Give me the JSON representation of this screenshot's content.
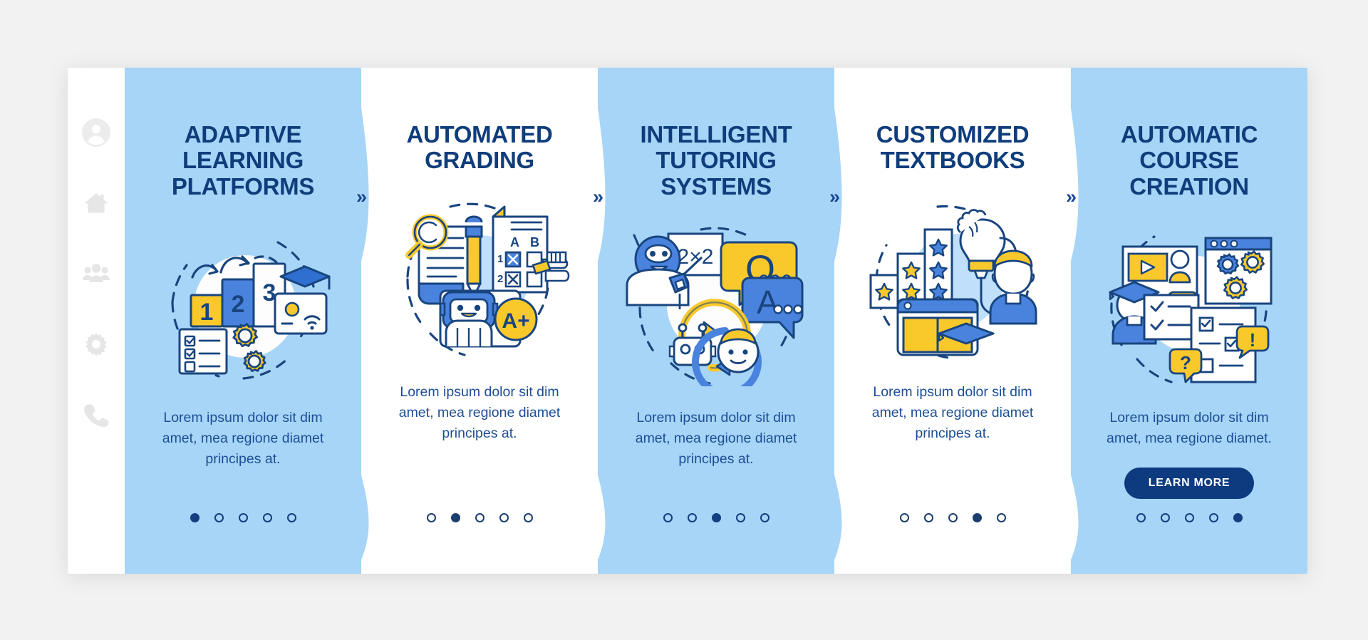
{
  "page": {
    "background_color": "#f2f2f2",
    "card_background": "#ffffff",
    "accent_blue": "#a6d5f7",
    "navy": "#0f3d7c",
    "yellow": "#f9c92c",
    "mid_blue": "#4a83dd"
  },
  "sidebar": {
    "items": [
      {
        "icon": "user-avatar-icon",
        "name": "sidebar-item-account"
      },
      {
        "icon": "home-icon",
        "name": "sidebar-item-home"
      },
      {
        "icon": "people-group-icon",
        "name": "sidebar-item-community"
      },
      {
        "icon": "gear-icon",
        "name": "sidebar-item-settings"
      },
      {
        "icon": "phone-icon",
        "name": "sidebar-item-contact"
      }
    ]
  },
  "separator": {
    "glyph": "»"
  },
  "panels": [
    {
      "title": "ADAPTIVE\nLEARNING\nPLATFORMS",
      "description": "Lorem ipsum dolor sit dim\namet, mea regione diamet\nprincipes at.",
      "theme": "blue",
      "illustration": "adaptive-learning-illustration",
      "dots": {
        "count": 5,
        "active": 0
      },
      "has_button": false,
      "button_label": ""
    },
    {
      "title": "AUTOMATED\nGRADING",
      "description": "Lorem ipsum dolor sit dim\namet, mea regione diamet\nprincipes at.",
      "theme": "white",
      "illustration": "automated-grading-illustration",
      "dots": {
        "count": 5,
        "active": 1
      },
      "has_button": false,
      "button_label": ""
    },
    {
      "title": "INTELLIGENT\nTUTORING\nSYSTEMS",
      "description": "Lorem ipsum dolor sit dim\namet, mea regione diamet\nprincipes at.",
      "theme": "blue",
      "illustration": "intelligent-tutoring-illustration",
      "dots": {
        "count": 5,
        "active": 2
      },
      "has_button": false,
      "button_label": ""
    },
    {
      "title": "CUSTOMIZED\nTEXTBOOKS",
      "description": "Lorem ipsum dolor sit dim\namet, mea regione diamet\nprincipes at.",
      "theme": "white",
      "illustration": "customized-textbooks-illustration",
      "dots": {
        "count": 5,
        "active": 3
      },
      "has_button": false,
      "button_label": ""
    },
    {
      "title": "AUTOMATIC\nCOURSE\nCREATION",
      "description": "Lorem ipsum dolor sit dim\namet, mea regione diamet.",
      "theme": "blue",
      "illustration": "automatic-course-creation-illustration",
      "dots": {
        "count": 5,
        "active": 4
      },
      "has_button": true,
      "button_label": "LEARN MORE"
    }
  ],
  "illustration_labels": {
    "step_one": "1",
    "step_two": "2",
    "step_three": "3",
    "grade": "A+",
    "answer_a": "A",
    "answer_b": "B",
    "row_one": "1",
    "row_two": "2",
    "math": "2×2",
    "question_letter": "Q",
    "answer_letter": "A",
    "exclamation": "!",
    "question_mark": "?"
  }
}
